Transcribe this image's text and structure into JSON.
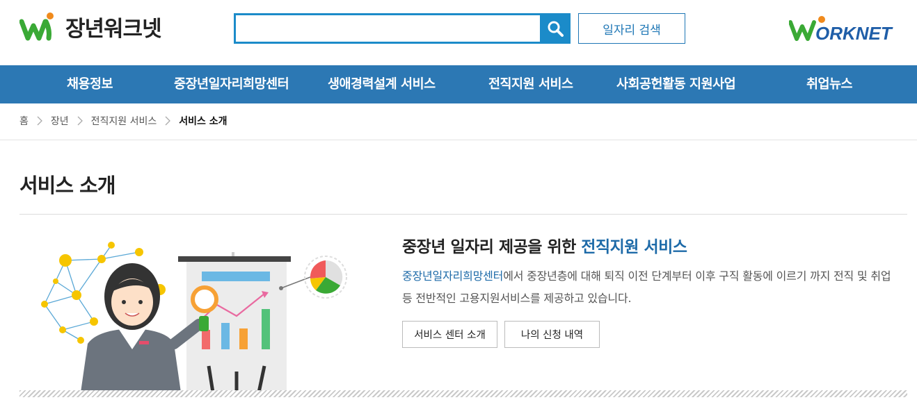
{
  "header": {
    "logo_text": "장년워크넷",
    "search": {
      "value": "",
      "placeholder": ""
    },
    "job_search_label": "일자리 검색",
    "partner_logo_text": "WORKNET"
  },
  "nav": {
    "items": [
      "채용정보",
      "중장년일자리희망센터",
      "생애경력설계 서비스",
      "전직지원 서비스",
      "사회공헌활동 지원사업",
      "취업뉴스"
    ]
  },
  "breadcrumb": [
    "홈",
    "장년",
    "전직지원 서비스",
    "서비스 소개"
  ],
  "page": {
    "title": "서비스 소개",
    "heading_prefix": "중장년 일자리 제공을 위한 ",
    "heading_highlight": "전직지원 서비스",
    "desc_highlight": "중장년일자리희망센터",
    "desc_rest": "에서 중장년층에 대해 퇴직 이전 단계부터 이후 구직 활동에 이르기 까지 전직 및 취업 등 전반적인 고용지원서비스를 제공하고 있습니다.",
    "buttons": [
      "서비스 센터 소개",
      "나의 신청 내역"
    ]
  },
  "colors": {
    "nav_bg": "#2c78b4",
    "accent": "#1b8bc9",
    "highlight_text": "#1d6aa8",
    "logo_green": "#3aa935",
    "logo_orange": "#f08a1c"
  },
  "icons": [
    "search-icon",
    "chevron-right-icon"
  ]
}
